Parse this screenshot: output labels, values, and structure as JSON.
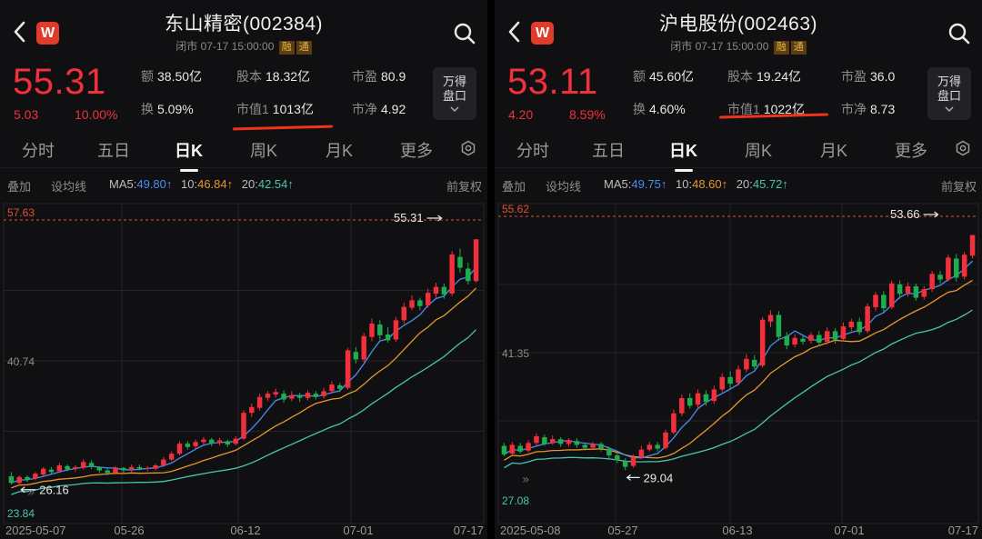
{
  "colors": {
    "up": "#f2303b",
    "down": "#1fae4f",
    "ma5": "#4b8df0",
    "ma10": "#e8962c",
    "ma20": "#47c6b2",
    "accent": "#f0341c"
  },
  "icons": {
    "back": "chevron-left-icon",
    "logo": "wind-logo-icon",
    "search": "search-icon",
    "settings": "gear-icon",
    "expand": "chevron-down-icon"
  },
  "panels": [
    {
      "title": "东山精密(002384)",
      "status": "闭市",
      "datetime": "07-17 15:00:00",
      "tag1": "融",
      "tag2": "通",
      "price": "55.31",
      "change": "5.03",
      "change_pct": "10.00%",
      "stats": {
        "amount_k": "额",
        "amount_v": "38.50亿",
        "turnover_k": "换",
        "turnover_v": "5.09%",
        "shares_k": "股本",
        "shares_v": "18.32亿",
        "mcap_k": "市值1",
        "mcap_v": "1013亿",
        "pe_k": "市盈",
        "pe_v": "80.9",
        "pb_k": "市净",
        "pb_v": "4.92"
      },
      "depth_button": [
        "万得",
        "盘口"
      ],
      "tabs": [
        "分时",
        "五日",
        "日K",
        "周K",
        "月K",
        "更多"
      ],
      "active_tab": "日K",
      "toolbar": {
        "overlay": "叠加",
        "ma_setting": "设均线",
        "adjust": "前复权"
      },
      "ma": {
        "ma5_label": "MA5:",
        "ma5": "49.80",
        "ma10_label": "10:",
        "ma10": "46.84",
        "ma20_label": "20:",
        "ma20": "42.54"
      },
      "chart_data": {
        "type": "candlestick",
        "y_max_label": "57.63",
        "y_mid_label": "40.74",
        "y_min_label": "23.84",
        "ylim": [
          23.84,
          57.63
        ],
        "x_ticks": [
          "2025-05-07",
          "05-26",
          "06-12",
          "07-01",
          "07-17"
        ],
        "last_close_label": "55.31",
        "low_marker_label": "26.16",
        "low_marker_value": 26.16,
        "high_marker_value": 55.31,
        "candles": [
          [
            26.9,
            26.1,
            27.4,
            25.9
          ],
          [
            26.1,
            26.8,
            27.0,
            25.8
          ],
          [
            26.8,
            26.5,
            27.0,
            26.2
          ],
          [
            26.6,
            27.2,
            27.4,
            26.4
          ],
          [
            27.1,
            27.8,
            28.0,
            26.9
          ],
          [
            27.7,
            27.4,
            28.0,
            27.2
          ],
          [
            27.5,
            28.2,
            28.5,
            27.3
          ],
          [
            28.1,
            27.7,
            28.3,
            27.5
          ],
          [
            27.8,
            28.0,
            28.2,
            27.4
          ],
          [
            27.9,
            28.6,
            28.9,
            27.7
          ],
          [
            28.5,
            28.0,
            28.8,
            27.8
          ],
          [
            28.0,
            27.6,
            28.1,
            27.3
          ],
          [
            27.6,
            27.3,
            27.8,
            27.0
          ],
          [
            27.3,
            27.9,
            28.1,
            27.1
          ],
          [
            27.9,
            27.6,
            28.0,
            27.3
          ],
          [
            27.7,
            28.0,
            28.3,
            27.4
          ],
          [
            28.0,
            27.8,
            28.3,
            27.6
          ],
          [
            27.8,
            27.9,
            28.1,
            27.5
          ],
          [
            27.8,
            28.2,
            28.4,
            27.6
          ],
          [
            28.2,
            28.9,
            29.2,
            28.0
          ],
          [
            28.9,
            29.6,
            29.9,
            28.7
          ],
          [
            29.6,
            30.8,
            31.1,
            29.4
          ],
          [
            30.8,
            30.4,
            31.1,
            30.1
          ],
          [
            30.5,
            31.0,
            31.3,
            30.2
          ],
          [
            31.0,
            31.3,
            31.6,
            30.7
          ],
          [
            31.3,
            30.8,
            31.5,
            30.5
          ],
          [
            30.9,
            31.2,
            31.5,
            30.6
          ],
          [
            31.1,
            30.7,
            31.3,
            30.4
          ],
          [
            30.8,
            31.4,
            31.7,
            30.6
          ],
          [
            31.4,
            34.5,
            34.8,
            31.2
          ],
          [
            34.5,
            35.2,
            35.6,
            34.0
          ],
          [
            35.1,
            36.4,
            36.8,
            34.8
          ],
          [
            36.3,
            36.8,
            37.1,
            35.9
          ],
          [
            36.7,
            37.0,
            37.4,
            36.3
          ],
          [
            36.8,
            36.1,
            37.2,
            35.7
          ],
          [
            36.2,
            36.6,
            37.1,
            35.9
          ],
          [
            36.6,
            36.3,
            36.9,
            35.8
          ],
          [
            36.3,
            36.9,
            37.2,
            36.0
          ],
          [
            36.8,
            36.4,
            37.1,
            36.1
          ],
          [
            36.5,
            37.1,
            37.5,
            36.2
          ],
          [
            37.1,
            37.9,
            38.3,
            36.8
          ],
          [
            37.8,
            37.4,
            38.1,
            37.0
          ],
          [
            37.5,
            42.0,
            42.3,
            37.3
          ],
          [
            41.8,
            40.9,
            42.4,
            40.4
          ],
          [
            40.9,
            43.7,
            44.1,
            40.6
          ],
          [
            43.6,
            45.2,
            45.8,
            43.1
          ],
          [
            45.1,
            43.8,
            45.6,
            43.3
          ],
          [
            43.9,
            43.2,
            44.8,
            42.9
          ],
          [
            43.3,
            45.6,
            46.0,
            43.0
          ],
          [
            45.6,
            47.2,
            47.7,
            45.2
          ],
          [
            47.1,
            48.0,
            48.6,
            46.8
          ],
          [
            48.0,
            47.3,
            48.3,
            46.8
          ],
          [
            47.4,
            48.9,
            49.4,
            47.1
          ],
          [
            48.8,
            49.6,
            50.1,
            48.3
          ],
          [
            49.6,
            48.7,
            50.0,
            48.2
          ],
          [
            48.8,
            53.5,
            53.9,
            48.5
          ],
          [
            53.2,
            51.9,
            54.2,
            51.3
          ],
          [
            51.8,
            50.3,
            52.5,
            49.9
          ],
          [
            50.3,
            55.31,
            55.31,
            50.1
          ]
        ]
      }
    },
    {
      "title": "沪电股份(002463)",
      "status": "闭市",
      "datetime": "07-17 15:00:00",
      "tag1": "融",
      "tag2": "通",
      "price": "53.11",
      "change": "4.20",
      "change_pct": "8.59%",
      "stats": {
        "amount_k": "额",
        "amount_v": "45.60亿",
        "turnover_k": "换",
        "turnover_v": "4.60%",
        "shares_k": "股本",
        "shares_v": "19.24亿",
        "mcap_k": "市值1",
        "mcap_v": "1022亿",
        "pe_k": "市盈",
        "pe_v": "36.0",
        "pb_k": "市净",
        "pb_v": "8.73"
      },
      "depth_button": [
        "万得",
        "盘口"
      ],
      "tabs": [
        "分时",
        "五日",
        "日K",
        "周K",
        "月K",
        "更多"
      ],
      "active_tab": "日K",
      "toolbar": {
        "overlay": "叠加",
        "ma_setting": "设均线",
        "adjust": "前复权"
      },
      "ma": {
        "ma5_label": "MA5:",
        "ma5": "49.75",
        "ma10_label": "10:",
        "ma10": "48.60",
        "ma20_label": "20:",
        "ma20": "45.72"
      },
      "chart_data": {
        "type": "candlestick",
        "y_max_label": "55.62",
        "y_mid_label": "41.35",
        "y_min_label": "27.08",
        "ylim": [
          27.08,
          55.62
        ],
        "x_ticks": [
          "2025-05-08",
          "05-27",
          "06-13",
          "07-01",
          "07-17"
        ],
        "last_close_label": "53.66",
        "low_marker_label": "29.04",
        "low_marker_value": 29.04,
        "high_marker_value": 53.66,
        "candles": [
          [
            31.6,
            30.7,
            31.9,
            30.5
          ],
          [
            30.8,
            31.7,
            32.0,
            30.6
          ],
          [
            31.6,
            31.0,
            31.9,
            30.8
          ],
          [
            31.1,
            31.9,
            32.2,
            30.9
          ],
          [
            31.9,
            32.6,
            32.9,
            31.6
          ],
          [
            32.5,
            31.8,
            32.8,
            31.6
          ],
          [
            31.9,
            32.3,
            32.7,
            31.7
          ],
          [
            32.3,
            31.8,
            32.5,
            31.5
          ],
          [
            31.8,
            32.2,
            32.4,
            31.5
          ],
          [
            32.1,
            31.7,
            32.4,
            31.4
          ],
          [
            31.7,
            31.4,
            31.9,
            31.1
          ],
          [
            31.4,
            31.8,
            32.0,
            31.2
          ],
          [
            31.8,
            31.3,
            32.0,
            31.0
          ],
          [
            31.3,
            30.6,
            31.5,
            30.3
          ],
          [
            30.6,
            30.1,
            30.8,
            29.8
          ],
          [
            30.0,
            29.4,
            30.3,
            29.04
          ],
          [
            29.5,
            30.4,
            30.7,
            29.3
          ],
          [
            30.4,
            31.2,
            31.6,
            30.2
          ],
          [
            31.2,
            31.7,
            32.0,
            31.0
          ],
          [
            31.7,
            31.3,
            32.0,
            31.0
          ],
          [
            31.4,
            33.0,
            33.3,
            31.2
          ],
          [
            33.0,
            35.0,
            35.4,
            32.8
          ],
          [
            35.0,
            36.6,
            37.0,
            34.7
          ],
          [
            36.6,
            35.8,
            37.1,
            35.5
          ],
          [
            35.9,
            37.1,
            37.5,
            35.6
          ],
          [
            37.0,
            36.2,
            37.4,
            35.8
          ],
          [
            36.3,
            37.5,
            37.9,
            36.0
          ],
          [
            37.5,
            38.8,
            39.2,
            37.2
          ],
          [
            38.8,
            38.1,
            39.4,
            37.6
          ],
          [
            38.2,
            39.6,
            40.0,
            37.9
          ],
          [
            39.6,
            40.7,
            41.2,
            39.3
          ],
          [
            40.6,
            39.9,
            41.1,
            39.6
          ],
          [
            40.0,
            44.8,
            45.1,
            39.8
          ],
          [
            44.6,
            45.3,
            45.8,
            44.0
          ],
          [
            45.3,
            43.0,
            45.7,
            42.6
          ],
          [
            43.1,
            42.1,
            43.5,
            41.7
          ],
          [
            42.2,
            42.9,
            43.3,
            41.9
          ],
          [
            42.8,
            42.5,
            43.1,
            42.2
          ],
          [
            42.6,
            43.2,
            43.5,
            42.3
          ],
          [
            43.2,
            42.4,
            43.6,
            42.1
          ],
          [
            42.5,
            43.6,
            44.0,
            42.2
          ],
          [
            43.6,
            42.7,
            43.9,
            42.3
          ],
          [
            42.8,
            44.1,
            44.5,
            42.5
          ],
          [
            44.0,
            44.6,
            44.9,
            43.6
          ],
          [
            44.6,
            43.5,
            45.0,
            43.2
          ],
          [
            43.6,
            46.2,
            46.5,
            43.4
          ],
          [
            46.1,
            47.4,
            47.7,
            45.7
          ],
          [
            47.4,
            46.0,
            47.8,
            45.6
          ],
          [
            46.1,
            48.6,
            48.9,
            45.9
          ],
          [
            48.5,
            47.5,
            48.9,
            47.0
          ],
          [
            47.6,
            48.3,
            48.7,
            47.2
          ],
          [
            48.3,
            47.1,
            48.6,
            46.8
          ],
          [
            47.2,
            48.0,
            48.3,
            46.9
          ],
          [
            48.0,
            49.6,
            49.9,
            47.7
          ],
          [
            49.5,
            49.0,
            49.9,
            48.6
          ],
          [
            49.0,
            51.3,
            51.6,
            48.8
          ],
          [
            51.2,
            49.2,
            51.7,
            48.8
          ],
          [
            49.3,
            51.6,
            51.9,
            49.0
          ],
          [
            51.5,
            53.66,
            53.66,
            51.2
          ]
        ]
      }
    }
  ]
}
